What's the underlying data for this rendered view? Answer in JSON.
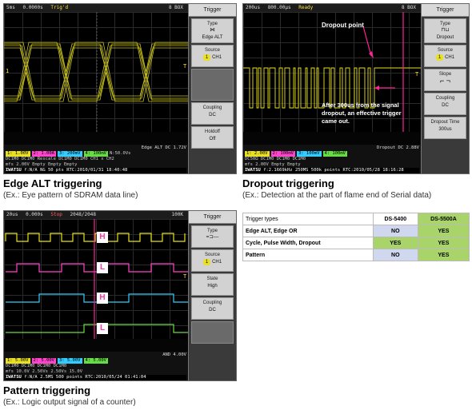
{
  "panel1": {
    "topbar": [
      "5ms",
      "0.0000s",
      "Trig'd"
    ],
    "topbar_right": "8 BOX",
    "menu_title": "Trigger",
    "type_label": "Type",
    "type_value": "Edge ALT",
    "source_label": "Source",
    "source_value": "CH1",
    "coupling_label": "Coupling",
    "coupling_value": "DC",
    "holdoff_label": "Holdoff",
    "holdoff_value": "Off",
    "status_line": "Edge ALT    DC    1.72V",
    "ch_row": [
      "1: 1.00V",
      "2: 1.00A",
      "3: 200mV",
      "4: 100mV",
      "N:50.0Vs"
    ],
    "ch_row2": [
      "DC1M0",
      "DC1M0 Rescale",
      "DC1M0",
      "DC1M0",
      "CH1 x CH2"
    ],
    "ch_row3": [
      "mfs",
      "2.00V",
      "Empty",
      "Empty",
      "Empty"
    ],
    "footer": [
      "IWATSU",
      "f:N/A",
      "NG",
      "50 pts",
      "RTC:2010/01/31 18:40:48"
    ],
    "caption_title": "Edge ALT triggering",
    "caption_sub": "(Ex.: Eye pattern of SDRAM data line)"
  },
  "panel2": {
    "topbar": [
      "200us",
      "800.00μs",
      "Ready"
    ],
    "topbar_right": "8 BOX",
    "menu_title": "Trigger",
    "type_label": "Type",
    "type_value": "Dropout",
    "source_label": "Source",
    "source_value": "CH1",
    "slope_label": "Slope",
    "coupling_label": "Coupling",
    "coupling_value": "DC",
    "dropout_label": "Dropout Time",
    "dropout_value": "300us",
    "annot_dropout": "Dropout point",
    "annot_after": "After 300us from the signal dropout, an effective trigger came out.",
    "status_line": "Dropout    DC    2.88V",
    "ch_row": [
      "1: 2.00V",
      "2: 100mV",
      "3: 100mV",
      "4: 100mV"
    ],
    "ch_row2": [
      "DC50Ω",
      "DC1M0",
      "DC1M0",
      "DC1M0"
    ],
    "ch_row3": [
      "mfs",
      "2.00V",
      "Empty",
      "Empty"
    ],
    "footer": [
      "IWATSU",
      "f:2.1669kHz",
      "250MS 500k points",
      "RTC:2010/05/28 18:16:28"
    ],
    "caption_title": "Dropout triggering",
    "caption_sub": "(Ex.: Detection at the part of flame end of Serial data)"
  },
  "panel3": {
    "topbar": [
      "20us",
      "0.000s",
      "Stop"
    ],
    "topbar_mid": "2048/2048",
    "topbar_right": "100K",
    "menu_title": "Trigger",
    "type_label": "Type",
    "source_label": "Source",
    "source_value": "CH1",
    "state_label": "State",
    "state_value": "High",
    "coupling_label": "Coupling",
    "coupling_value": "DC",
    "status_line": "AND    4.00V",
    "ch_row": [
      "1: 5.00V",
      "2: 5.00V",
      "3: 5.00V",
      "4: 5.00V"
    ],
    "ch_row2": [
      "DC1M0",
      "DC1M0",
      "DC1M0",
      "DC1M0"
    ],
    "ch_row3": [
      "mfs",
      "10.0V",
      "2.50Vs",
      "2.50Vs",
      "15.0V"
    ],
    "footer": [
      "IWATSU",
      "f:N/A",
      "2.5MS 500 points",
      "RTC:2010/05/24 01:41:04"
    ],
    "marks": [
      "H",
      "L",
      "H",
      "L"
    ],
    "caption_title": "Pattern triggering",
    "caption_sub": "(Ex.: Logic output signal of a counter)"
  },
  "table": {
    "header": [
      "Trigger types",
      "DS-5400",
      "DS-5500A"
    ],
    "rows": [
      {
        "label": "Edge ALT, Edge OR",
        "a": "NO",
        "b": "YES"
      },
      {
        "label": "Cycle, Pulse Width, Dropout",
        "a": "YES",
        "b": "YES"
      },
      {
        "label": "Pattern",
        "a": "NO",
        "b": "YES"
      }
    ]
  },
  "colors": {
    "ch1": "#e8e020",
    "ch2": "#ff44cc",
    "ch3": "#33ccff",
    "ch4": "#66dd44",
    "marker": "#ff2299"
  }
}
